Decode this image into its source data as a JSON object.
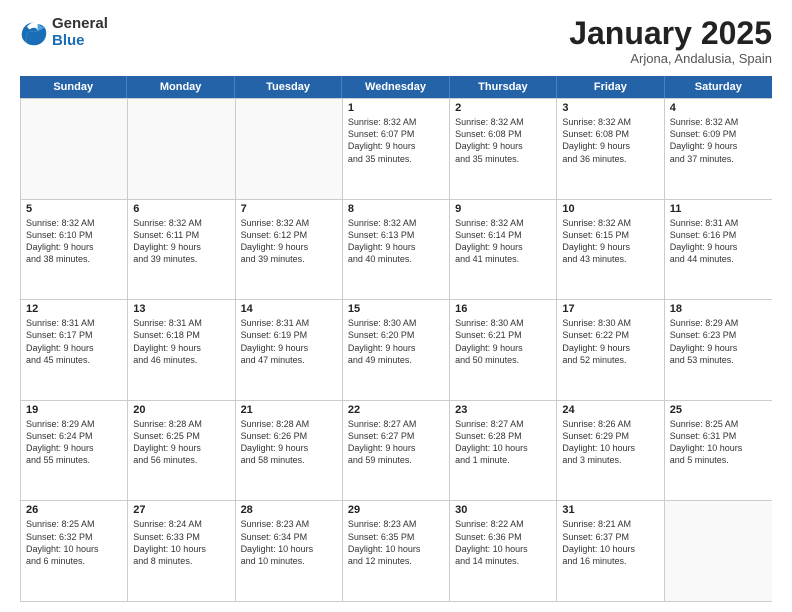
{
  "header": {
    "logo_general": "General",
    "logo_blue": "Blue",
    "month_title": "January 2025",
    "subtitle": "Arjona, Andalusia, Spain"
  },
  "weekdays": [
    "Sunday",
    "Monday",
    "Tuesday",
    "Wednesday",
    "Thursday",
    "Friday",
    "Saturday"
  ],
  "rows": [
    [
      {
        "day": "",
        "text": ""
      },
      {
        "day": "",
        "text": ""
      },
      {
        "day": "",
        "text": ""
      },
      {
        "day": "1",
        "text": "Sunrise: 8:32 AM\nSunset: 6:07 PM\nDaylight: 9 hours\nand 35 minutes."
      },
      {
        "day": "2",
        "text": "Sunrise: 8:32 AM\nSunset: 6:08 PM\nDaylight: 9 hours\nand 35 minutes."
      },
      {
        "day": "3",
        "text": "Sunrise: 8:32 AM\nSunset: 6:08 PM\nDaylight: 9 hours\nand 36 minutes."
      },
      {
        "day": "4",
        "text": "Sunrise: 8:32 AM\nSunset: 6:09 PM\nDaylight: 9 hours\nand 37 minutes."
      }
    ],
    [
      {
        "day": "5",
        "text": "Sunrise: 8:32 AM\nSunset: 6:10 PM\nDaylight: 9 hours\nand 38 minutes."
      },
      {
        "day": "6",
        "text": "Sunrise: 8:32 AM\nSunset: 6:11 PM\nDaylight: 9 hours\nand 39 minutes."
      },
      {
        "day": "7",
        "text": "Sunrise: 8:32 AM\nSunset: 6:12 PM\nDaylight: 9 hours\nand 39 minutes."
      },
      {
        "day": "8",
        "text": "Sunrise: 8:32 AM\nSunset: 6:13 PM\nDaylight: 9 hours\nand 40 minutes."
      },
      {
        "day": "9",
        "text": "Sunrise: 8:32 AM\nSunset: 6:14 PM\nDaylight: 9 hours\nand 41 minutes."
      },
      {
        "day": "10",
        "text": "Sunrise: 8:32 AM\nSunset: 6:15 PM\nDaylight: 9 hours\nand 43 minutes."
      },
      {
        "day": "11",
        "text": "Sunrise: 8:31 AM\nSunset: 6:16 PM\nDaylight: 9 hours\nand 44 minutes."
      }
    ],
    [
      {
        "day": "12",
        "text": "Sunrise: 8:31 AM\nSunset: 6:17 PM\nDaylight: 9 hours\nand 45 minutes."
      },
      {
        "day": "13",
        "text": "Sunrise: 8:31 AM\nSunset: 6:18 PM\nDaylight: 9 hours\nand 46 minutes."
      },
      {
        "day": "14",
        "text": "Sunrise: 8:31 AM\nSunset: 6:19 PM\nDaylight: 9 hours\nand 47 minutes."
      },
      {
        "day": "15",
        "text": "Sunrise: 8:30 AM\nSunset: 6:20 PM\nDaylight: 9 hours\nand 49 minutes."
      },
      {
        "day": "16",
        "text": "Sunrise: 8:30 AM\nSunset: 6:21 PM\nDaylight: 9 hours\nand 50 minutes."
      },
      {
        "day": "17",
        "text": "Sunrise: 8:30 AM\nSunset: 6:22 PM\nDaylight: 9 hours\nand 52 minutes."
      },
      {
        "day": "18",
        "text": "Sunrise: 8:29 AM\nSunset: 6:23 PM\nDaylight: 9 hours\nand 53 minutes."
      }
    ],
    [
      {
        "day": "19",
        "text": "Sunrise: 8:29 AM\nSunset: 6:24 PM\nDaylight: 9 hours\nand 55 minutes."
      },
      {
        "day": "20",
        "text": "Sunrise: 8:28 AM\nSunset: 6:25 PM\nDaylight: 9 hours\nand 56 minutes."
      },
      {
        "day": "21",
        "text": "Sunrise: 8:28 AM\nSunset: 6:26 PM\nDaylight: 9 hours\nand 58 minutes."
      },
      {
        "day": "22",
        "text": "Sunrise: 8:27 AM\nSunset: 6:27 PM\nDaylight: 9 hours\nand 59 minutes."
      },
      {
        "day": "23",
        "text": "Sunrise: 8:27 AM\nSunset: 6:28 PM\nDaylight: 10 hours\nand 1 minute."
      },
      {
        "day": "24",
        "text": "Sunrise: 8:26 AM\nSunset: 6:29 PM\nDaylight: 10 hours\nand 3 minutes."
      },
      {
        "day": "25",
        "text": "Sunrise: 8:25 AM\nSunset: 6:31 PM\nDaylight: 10 hours\nand 5 minutes."
      }
    ],
    [
      {
        "day": "26",
        "text": "Sunrise: 8:25 AM\nSunset: 6:32 PM\nDaylight: 10 hours\nand 6 minutes."
      },
      {
        "day": "27",
        "text": "Sunrise: 8:24 AM\nSunset: 6:33 PM\nDaylight: 10 hours\nand 8 minutes."
      },
      {
        "day": "28",
        "text": "Sunrise: 8:23 AM\nSunset: 6:34 PM\nDaylight: 10 hours\nand 10 minutes."
      },
      {
        "day": "29",
        "text": "Sunrise: 8:23 AM\nSunset: 6:35 PM\nDaylight: 10 hours\nand 12 minutes."
      },
      {
        "day": "30",
        "text": "Sunrise: 8:22 AM\nSunset: 6:36 PM\nDaylight: 10 hours\nand 14 minutes."
      },
      {
        "day": "31",
        "text": "Sunrise: 8:21 AM\nSunset: 6:37 PM\nDaylight: 10 hours\nand 16 minutes."
      },
      {
        "day": "",
        "text": ""
      }
    ]
  ]
}
